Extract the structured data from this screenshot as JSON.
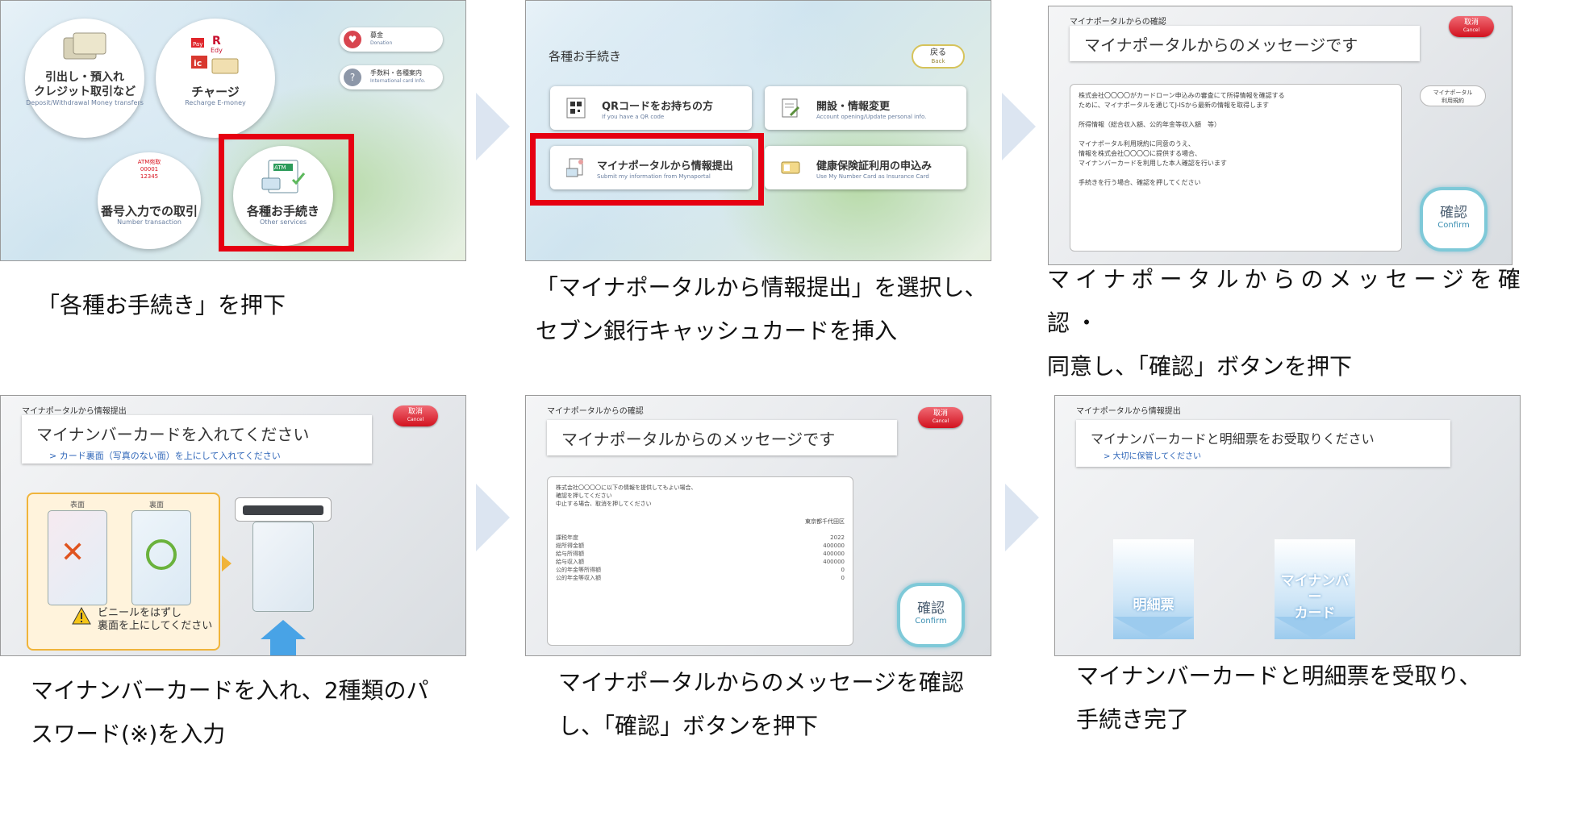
{
  "arrows": 4,
  "panel1": {
    "circles": [
      {
        "jp": "引出し・預入れ\nクレジット取引など",
        "en": "Deposit/Withdrawal Money transfers"
      },
      {
        "jp": "チャージ",
        "en": "Recharge E-money"
      },
      {
        "jp": "番号入力での取引",
        "en": "Number transaction"
      },
      {
        "jp": "各種お手続き",
        "en": "Other services"
      }
    ],
    "small_buttons": [
      {
        "jp": "募金",
        "en": "Donation"
      },
      {
        "jp": "手数料・各種案内",
        "en": "International card Info."
      }
    ],
    "atm_icon": "ATM",
    "charge_icon": {
      "r": "R",
      "edy": "Edy",
      "pay": "Pay",
      "ic": "ic"
    },
    "number_icon": "ATM宛取\n00001\n12345"
  },
  "panel2": {
    "header": "各種お手続き",
    "back": {
      "jp": "戻る",
      "en": "Back"
    },
    "options": [
      {
        "jp": "QRコードをお持ちの方",
        "en": "If you have a QR code"
      },
      {
        "jp": "開設・情報変更",
        "en": "Account opening/Update personal info."
      },
      {
        "jp": "マイナポータルから情報提出",
        "en": "Submit my information from Mynaportal"
      },
      {
        "jp": "健康保険証利用の申込み",
        "en": "Use My Number Card as Insurance Card"
      }
    ]
  },
  "panel3": {
    "screen_title": "マイナポータルからの確認",
    "message": "マイナポータルからのメッセージです",
    "cancel": {
      "jp": "取消",
      "en": "Cancel"
    },
    "rules": "マイナポータル\n利用規約",
    "content": [
      "株式会社〇〇〇〇がカードローン申込みの審査にて所得情報を確認する",
      "ために、マイナポータルを通じてJ-ISから最新の情報を取得します",
      "",
      "所得情報（総合収入額、公的年金等収入額　等）",
      "",
      "マイナポータル利用規約に同意のうえ、",
      "情報を株式会社〇〇〇〇に提供する場合、",
      "マイナンバーカードを利用した本人確認を行います",
      "",
      "手続きを行う場合、確認を押してください"
    ],
    "confirm": {
      "jp": "確認",
      "en": "Confirm"
    }
  },
  "panel4": {
    "screen_title": "マイナポータルから情報提出",
    "message": "マイナンバーカードを入れてください",
    "sub": "> カード裏面（写真のない面）を上にして入れてください",
    "cancel": {
      "jp": "取消",
      "en": "Cancel"
    },
    "front": "表面",
    "back": "裏面",
    "warning": "ビニールをはずし\n裏面を上にしてください"
  },
  "panel5": {
    "screen_title": "マイナポータルからの確認",
    "message": "マイナポータルからのメッセージです",
    "cancel": {
      "jp": "取消",
      "en": "Cancel"
    },
    "content_lines": [
      "株式会社〇〇〇〇に以下の情報を提供してもよい場合、",
      "確認を押してください",
      "中止する場合、取消を押してください"
    ],
    "location": "東京都千代田区",
    "rows": [
      {
        "k": "課税年度",
        "v": "2022"
      },
      {
        "k": "総所得金額",
        "v": "400000"
      },
      {
        "k": "給与所得額",
        "v": "400000"
      },
      {
        "k": "給与収入額",
        "v": "400000"
      },
      {
        "k": "公的年金等所得額",
        "v": "0"
      },
      {
        "k": "公的年金等収入額",
        "v": "0"
      }
    ],
    "confirm": {
      "jp": "確認",
      "en": "Confirm"
    }
  },
  "panel6": {
    "screen_title": "マイナポータルから情報提出",
    "message": "マイナンバーカードと明細票をお受取りください",
    "sub": "> 大切に保管してください",
    "receipt": "明細票",
    "card": "マイナンバー\nカード"
  },
  "captions": {
    "c1": "「各種お手続き」を押下",
    "c2a": "「マイナポータルから情報提出」を選択し、",
    "c2b": "セブン銀行キャッシュカードを挿入",
    "c3a": "マイナポータルからのメッセージを確認・",
    "c3b": "同意し、「確認」ボタンを押下",
    "c4a": "マイナンバーカードを入れ、2種類のパ",
    "c4b": "スワード(※)を入力",
    "c5a": "マイナポータルからのメッセージを確認",
    "c5b": "し、「確認」ボタンを押下",
    "c6a": "マイナンバーカードと明細票を受取り、",
    "c6b": "手続き完了"
  },
  "colors": {
    "highlight": "#e60012",
    "arrow": "#dce5f1",
    "link": "#2f66b8",
    "confirm_border": "#7ec9d8"
  }
}
